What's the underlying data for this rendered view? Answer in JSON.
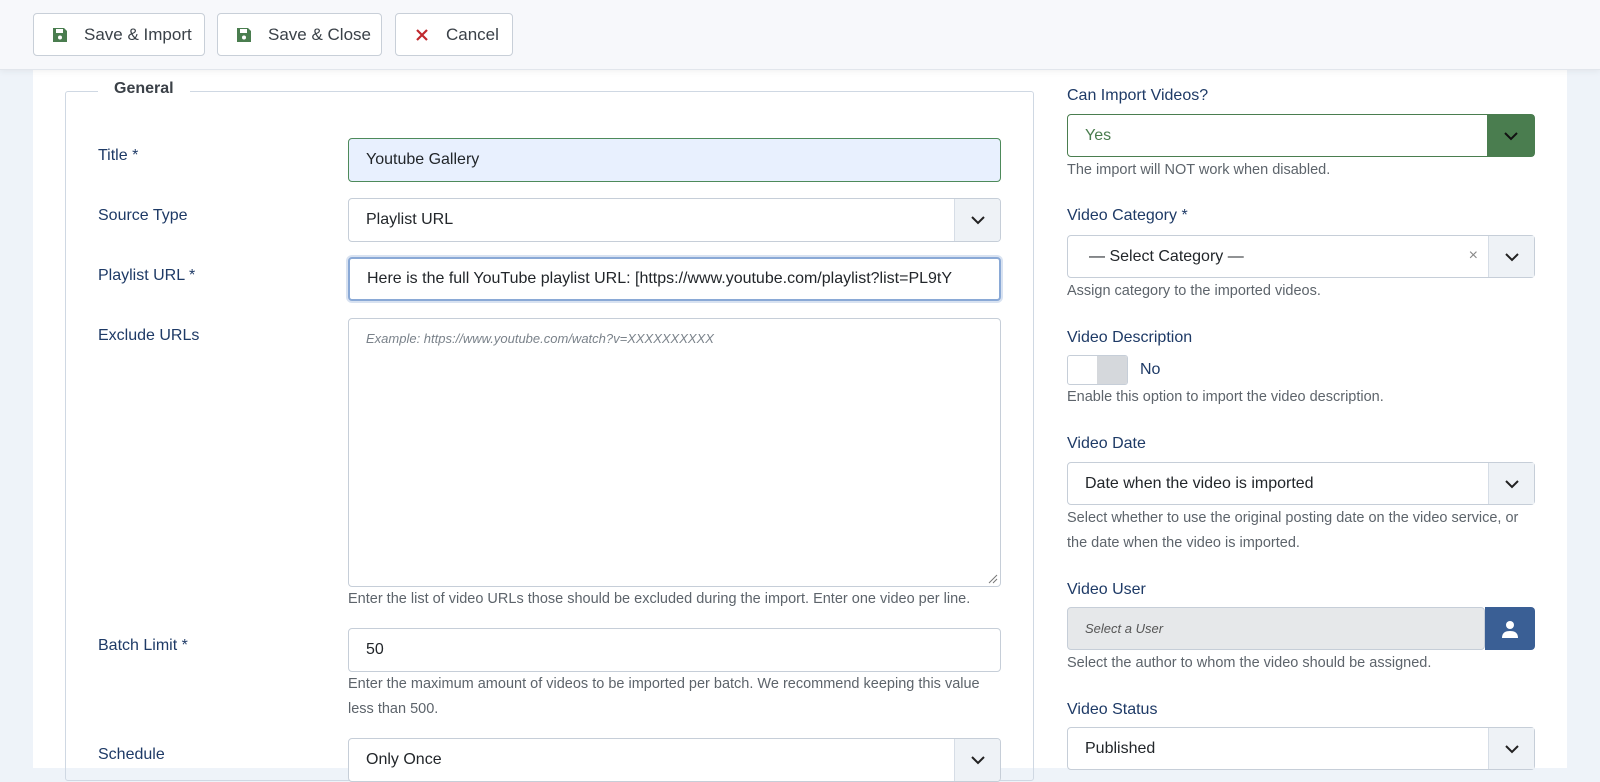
{
  "toolbar": {
    "save_import_label": "Save & Import",
    "save_close_label": "Save & Close",
    "cancel_label": "Cancel"
  },
  "colors": {
    "accent_green": "#4a7d4f",
    "cancel_red": "#c0282d",
    "label_blue": "#1e3a66",
    "user_button": "#3a5f95"
  },
  "general": {
    "legend": "General",
    "title_label": "Title *",
    "title_value": "Youtube Gallery",
    "source_type_label": "Source Type",
    "source_type_value": "Playlist URL",
    "playlist_url_label": "Playlist URL *",
    "playlist_url_value": "Here is the full YouTube playlist URL:  [https://www.youtube.com/playlist?list=PL9tY",
    "exclude_urls_label": "Exclude URLs",
    "exclude_urls_placeholder": "Example: https://www.youtube.com/watch?v=XXXXXXXXXX",
    "exclude_urls_help": "Enter the list of video URLs those should be excluded during the import. Enter one video per line.",
    "batch_limit_label": "Batch Limit *",
    "batch_limit_value": "50",
    "batch_limit_help": "Enter the maximum amount of videos to be imported per batch. We recommend keeping this value less than 500.",
    "schedule_label": "Schedule",
    "schedule_value": "Only Once"
  },
  "side": {
    "can_import_label": "Can Import Videos?",
    "can_import_value": "Yes",
    "can_import_help": "The import will NOT work when disabled.",
    "category_label": "Video Category *",
    "category_value": "— Select Category —",
    "category_clear": "×",
    "category_help": "Assign category to the imported videos.",
    "description_label": "Video Description",
    "description_value": "No",
    "description_help": "Enable this option to import the video description.",
    "date_label": "Video Date",
    "date_value": "Date when the video is imported",
    "date_help": "Select whether to use the original posting date on the video service, or the date when the video is imported.",
    "user_label": "Video User",
    "user_placeholder": "Select a User",
    "user_help": "Select the author to whom the video should be assigned.",
    "status_label": "Video Status",
    "status_value": "Published"
  }
}
